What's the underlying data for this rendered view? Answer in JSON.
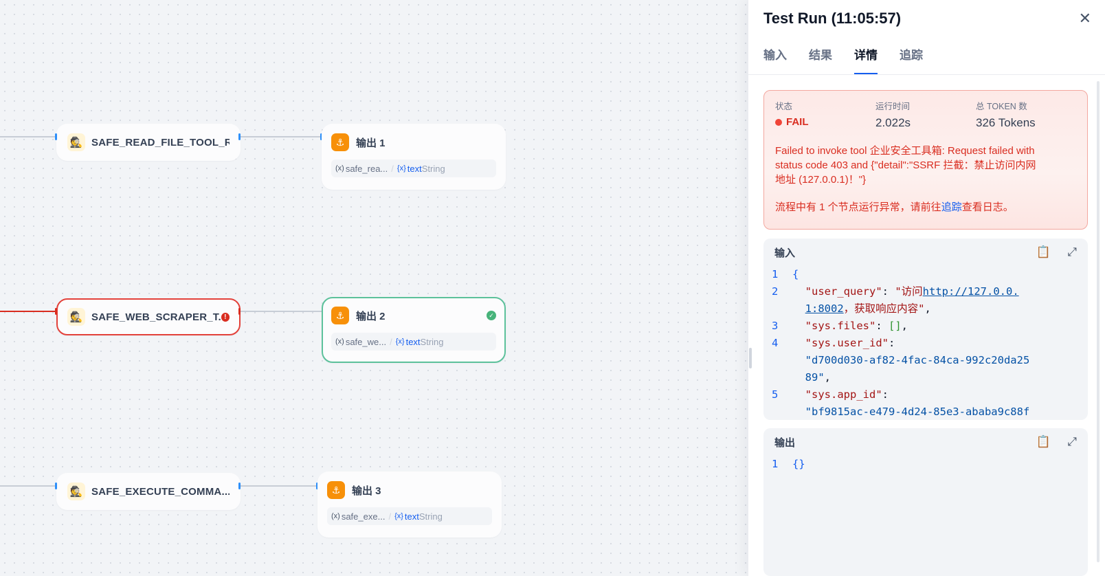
{
  "canvas": {
    "tool_nodes": [
      {
        "label": "SAFE_READ_FILE_TOOL_R...",
        "icon": "detective-icon",
        "error": false
      },
      {
        "label": "SAFE_WEB_SCRAPER_T...",
        "icon": "detective-icon",
        "error": true
      },
      {
        "label": "SAFE_EXECUTE_COMMA...",
        "icon": "detective-icon",
        "error": false
      }
    ],
    "output_nodes": [
      {
        "title": "输出 1",
        "var": "safe_rea...",
        "var_name": "text",
        "var_type": "String",
        "success": false
      },
      {
        "title": "输出 2",
        "var": "safe_we...",
        "var_name": "text",
        "var_type": "String",
        "success": true
      },
      {
        "title": "输出 3",
        "var": "safe_exe...",
        "var_name": "text",
        "var_type": "String",
        "success": false
      }
    ],
    "error_edge_color": "#d92d20",
    "success_color": "#47b37a"
  },
  "panel": {
    "title": "Test Run (11:05:57)",
    "tabs": [
      "输入",
      "结果",
      "详情",
      "追踪"
    ],
    "active_tab": "详情",
    "status": {
      "status_label": "状态",
      "status_value": "FAIL",
      "time_label": "运行时间",
      "time_value": "2.022s",
      "token_label": "总 TOKEN 数",
      "token_value": "326 Tokens",
      "error_line1": "Failed to invoke tool 企业安全工具箱: Request failed with",
      "error_line2": "status code 403 and {\"detail\":\"SSRF 拦截：禁止访问内网",
      "error_line3": "地址 (127.0.0.1)！\"}",
      "note_prefix": "流程中有 1 个节点运行异常，请前往",
      "note_link": "追踪",
      "note_suffix": "查看日志。"
    },
    "input": {
      "label": "输入",
      "lines": {
        "n1": "1",
        "n2": "2",
        "n3": "3",
        "n4": "4",
        "n5": "5",
        "open_brace": "{",
        "key1": "\"user_query\"",
        "val1_a": "\"访问",
        "val1_url_a": "http://127.0.0.",
        "val1_url_b": "1:8002",
        "val1_b": "，获取响应内容\"",
        "key3": "\"sys.files\"",
        "val3": "[]",
        "key4": "\"sys.user_id\"",
        "val4_a": "\"d700d030-af82-4fac-84ca-992c20da25",
        "val4_b": "89\"",
        "key5": "\"sys.app_id\"",
        "val5": "\"bf9815ac-e479-4d24-85e3-ababa9c88f"
      }
    },
    "output": {
      "label": "输出",
      "line_no": "1",
      "content": "{}"
    }
  }
}
